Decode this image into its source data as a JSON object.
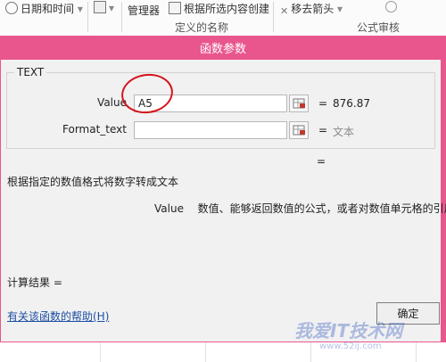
{
  "ribbon": {
    "date_time": "日期和时间",
    "manager": "管理器",
    "create_from_selection": "根据所选内容创建",
    "remove_arrows": "移去箭头",
    "group_defined_names": "定义的名称",
    "group_formula_auditing": "公式审核"
  },
  "dialog": {
    "title": "函数参数",
    "function_name": "TEXT",
    "args": [
      {
        "label": "Value",
        "input": "A5",
        "equals": "=",
        "result": "876.87"
      },
      {
        "label": "Format_text",
        "input": "",
        "equals": "=",
        "result": "文本"
      }
    ],
    "result_equals": "=",
    "description": "根据指定的数值格式将数字转成文本",
    "arg_desc_name": "Value",
    "arg_desc_text": "数值、能够返回数值的公式，或者对数值单元格的引用",
    "calc_result_label": "计算结果 =",
    "help_link": "有关该函数的帮助(H)",
    "ok_label": "确定"
  },
  "watermark": {
    "text": "我爱IT技术网",
    "url": "www.52ij.com"
  }
}
